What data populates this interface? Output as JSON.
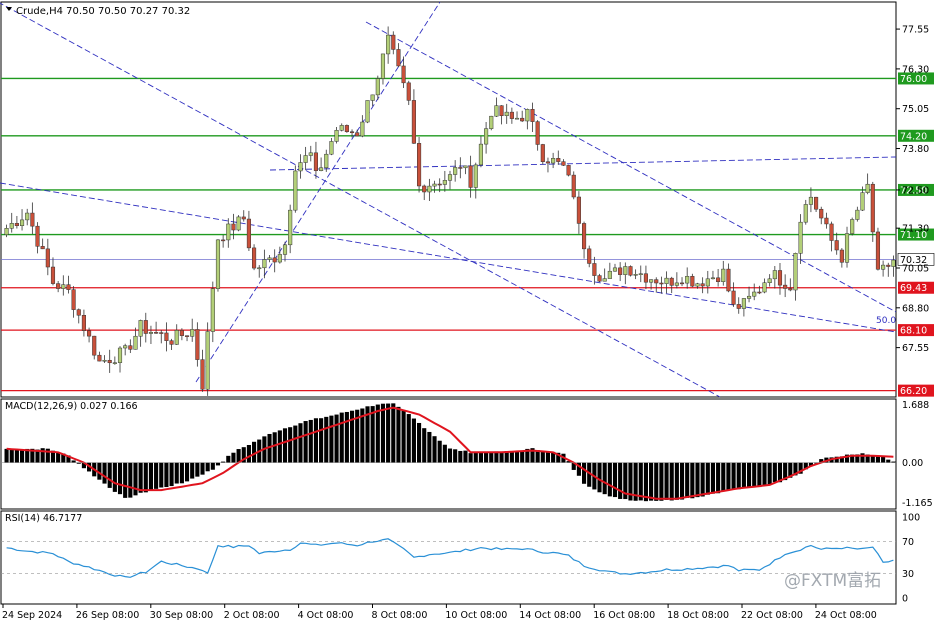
{
  "header": {
    "symbol_line": "Crude,H4  70.50 70.50 70.27 70.32",
    "symbol": "Crude",
    "timeframe": "H4",
    "open": 70.5,
    "high": 70.5,
    "low": 70.27,
    "close": 70.32
  },
  "colors": {
    "bull_candle": "#b3cf78",
    "bear_candle": "#c9503a",
    "wick": "#333333",
    "support_line": "#e0141e",
    "resistance_line": "#1f9a1f",
    "trend_line": "#3030c0",
    "macd_hist": "#000000",
    "macd_signal": "#e0141e",
    "rsi_line": "#2a90d6",
    "current_price_line": "#7070d0"
  },
  "chart_data": [
    {
      "type": "candlestick",
      "name": "price",
      "ylim": [
        66.0,
        78.4
      ],
      "yticks": [
        67.55,
        68.8,
        70.05,
        71.3,
        72.5,
        73.8,
        75.05,
        76.3,
        77.55
      ],
      "x": [
        "24 Sep 2024",
        "26 Sep 08:00",
        "30 Sep 08:00",
        "2 Oct 08:00",
        "4 Oct 08:00",
        "8 Oct 08:00",
        "10 Oct 08:00",
        "14 Oct 08:00",
        "16 Oct 08:00",
        "18 Oct 08:00",
        "22 Oct 08:00",
        "24 Oct 08:00"
      ],
      "horizontal_levels": [
        {
          "value": 76.0,
          "label": "76.00",
          "kind": "resistance"
        },
        {
          "value": 74.2,
          "label": "74.20",
          "kind": "resistance"
        },
        {
          "value": 72.5,
          "label": "72.50",
          "kind": "resistance"
        },
        {
          "value": 71.1,
          "label": "71.10",
          "kind": "resistance"
        },
        {
          "value": 69.43,
          "label": "69.43",
          "kind": "support"
        },
        {
          "value": 68.1,
          "label": "68.10",
          "kind": "support"
        },
        {
          "value": 66.2,
          "label": "66.20",
          "kind": "support"
        }
      ],
      "current_price": {
        "value": 70.32,
        "label": "70.32"
      },
      "annotation": "50.0",
      "anchors": [
        [
          71.3,
          0
        ],
        [
          71.8,
          4
        ],
        [
          69.6,
          9
        ],
        [
          69.3,
          12
        ],
        [
          67.1,
          18
        ],
        [
          67.4,
          23
        ],
        [
          68.2,
          26
        ],
        [
          67.8,
          32
        ],
        [
          68.1,
          36
        ],
        [
          66.4,
          38
        ],
        [
          71.0,
          41
        ],
        [
          71.6,
          46
        ],
        [
          70.0,
          48
        ],
        [
          70.4,
          52
        ],
        [
          70.8,
          54
        ],
        [
          73.3,
          56
        ],
        [
          73.6,
          59
        ],
        [
          72.9,
          60
        ],
        [
          74.4,
          64
        ],
        [
          74.3,
          68
        ],
        [
          76.1,
          72
        ],
        [
          77.2,
          74
        ],
        [
          75.2,
          78
        ],
        [
          72.6,
          80
        ],
        [
          72.9,
          86
        ],
        [
          73.3,
          88
        ],
        [
          72.8,
          90
        ],
        [
          75.0,
          94
        ],
        [
          74.7,
          98
        ],
        [
          74.9,
          101
        ],
        [
          73.6,
          104
        ],
        [
          73.2,
          108
        ],
        [
          72.4,
          110
        ],
        [
          71.3,
          111
        ],
        [
          70.8,
          112
        ],
        [
          70.0,
          114
        ],
        [
          69.7,
          116
        ],
        [
          70.1,
          120
        ],
        [
          69.8,
          124
        ],
        [
          69.6,
          128
        ],
        [
          69.8,
          131
        ],
        [
          69.6,
          134
        ],
        [
          69.9,
          139
        ],
        [
          68.8,
          141
        ],
        [
          68.9,
          143
        ],
        [
          69.4,
          146
        ],
        [
          69.9,
          148
        ],
        [
          69.5,
          152
        ],
        [
          71.7,
          154
        ],
        [
          72.3,
          156
        ],
        [
          70.9,
          160
        ],
        [
          70.4,
          162
        ],
        [
          71.5,
          164
        ],
        [
          72.6,
          167
        ],
        [
          69.8,
          169
        ],
        [
          70.3,
          172
        ]
      ]
    },
    {
      "type": "macd",
      "name": "MACD(12,26,9)",
      "label": "MACD(12,26,9) 0.027 0.166",
      "macd": 0.027,
      "signal": 0.166,
      "ylim": [
        -1.35,
        1.85
      ],
      "yticks": [
        1.688,
        0.0,
        -1.165
      ],
      "ytick_labels": [
        "1.688",
        "0.00",
        "-1.165"
      ],
      "hist_anchors": [
        [
          0.4,
          0
        ],
        [
          0.4,
          8
        ],
        [
          0.2,
          12
        ],
        [
          -0.5,
          18
        ],
        [
          -1.05,
          23
        ],
        [
          -0.8,
          28
        ],
        [
          -0.6,
          34
        ],
        [
          -0.2,
          40
        ],
        [
          0.3,
          44
        ],
        [
          0.6,
          48
        ],
        [
          0.9,
          52
        ],
        [
          1.2,
          58
        ],
        [
          1.4,
          64
        ],
        [
          1.55,
          68
        ],
        [
          1.7,
          72
        ],
        [
          1.7,
          75
        ],
        [
          1.4,
          78
        ],
        [
          0.9,
          82
        ],
        [
          0.4,
          86
        ],
        [
          0.3,
          90
        ],
        [
          0.3,
          96
        ],
        [
          0.4,
          102
        ],
        [
          0.25,
          108
        ],
        [
          -0.2,
          110
        ],
        [
          -0.6,
          112
        ],
        [
          -1.0,
          117
        ],
        [
          -1.1,
          122
        ],
        [
          -1.1,
          128
        ],
        [
          -1.0,
          134
        ],
        [
          -0.8,
          140
        ],
        [
          -0.7,
          146
        ],
        [
          -0.55,
          150
        ],
        [
          -0.3,
          154
        ],
        [
          -0.1,
          156
        ],
        [
          0.1,
          158
        ],
        [
          0.2,
          162
        ],
        [
          0.25,
          166
        ],
        [
          0.15,
          170
        ],
        [
          0.03,
          172
        ]
      ],
      "signal_anchors": [
        [
          0.4,
          0
        ],
        [
          0.3,
          10
        ],
        [
          0.0,
          15
        ],
        [
          -0.6,
          21
        ],
        [
          -0.8,
          26
        ],
        [
          -0.8,
          30
        ],
        [
          -0.6,
          38
        ],
        [
          -0.3,
          42
        ],
        [
          0.1,
          46
        ],
        [
          0.4,
          50
        ],
        [
          0.7,
          56
        ],
        [
          1.0,
          62
        ],
        [
          1.3,
          68
        ],
        [
          1.5,
          72
        ],
        [
          1.6,
          75
        ],
        [
          1.4,
          80
        ],
        [
          0.9,
          86
        ],
        [
          0.3,
          90
        ],
        [
          0.3,
          96
        ],
        [
          0.35,
          102
        ],
        [
          0.3,
          106
        ],
        [
          0.0,
          110
        ],
        [
          -0.5,
          115
        ],
        [
          -0.9,
          120
        ],
        [
          -1.05,
          126
        ],
        [
          -1.05,
          130
        ],
        [
          -0.9,
          136
        ],
        [
          -0.75,
          142
        ],
        [
          -0.65,
          148
        ],
        [
          -0.4,
          152
        ],
        [
          -0.1,
          156
        ],
        [
          0.1,
          160
        ],
        [
          0.2,
          164
        ],
        [
          0.2,
          168
        ],
        [
          0.17,
          172
        ]
      ]
    },
    {
      "type": "line",
      "name": "RSI(14)",
      "label": "RSI(14) 46.7177",
      "value": 46.7177,
      "ylim": [
        0,
        100
      ],
      "yticks": [
        100,
        70,
        30,
        0
      ],
      "levels": [
        70,
        30
      ],
      "anchors": [
        [
          62,
          0
        ],
        [
          58,
          4
        ],
        [
          55,
          9
        ],
        [
          45,
          12
        ],
        [
          38,
          16
        ],
        [
          30,
          20
        ],
        [
          25,
          23
        ],
        [
          32,
          27
        ],
        [
          45,
          30
        ],
        [
          40,
          34
        ],
        [
          35,
          38
        ],
        [
          30,
          39
        ],
        [
          65,
          41
        ],
        [
          63,
          44
        ],
        [
          65,
          47
        ],
        [
          55,
          49
        ],
        [
          58,
          52
        ],
        [
          60,
          55
        ],
        [
          68,
          57
        ],
        [
          65,
          60
        ],
        [
          68,
          64
        ],
        [
          65,
          68
        ],
        [
          70,
          71
        ],
        [
          72,
          74
        ],
        [
          60,
          77
        ],
        [
          50,
          79
        ],
        [
          54,
          82
        ],
        [
          56,
          86
        ],
        [
          58,
          88
        ],
        [
          62,
          92
        ],
        [
          60,
          96
        ],
        [
          61,
          100
        ],
        [
          57,
          104
        ],
        [
          55,
          107
        ],
        [
          52,
          109
        ],
        [
          48,
          110
        ],
        [
          40,
          112
        ],
        [
          35,
          115
        ],
        [
          32,
          117
        ],
        [
          30,
          120
        ],
        [
          32,
          124
        ],
        [
          35,
          128
        ],
        [
          36,
          132
        ],
        [
          38,
          136
        ],
        [
          40,
          140
        ],
        [
          34,
          142
        ],
        [
          35,
          146
        ],
        [
          46,
          149
        ],
        [
          55,
          151
        ],
        [
          58,
          153
        ],
        [
          65,
          156
        ],
        [
          60,
          158
        ],
        [
          62,
          162
        ],
        [
          60,
          166
        ],
        [
          63,
          168
        ],
        [
          43,
          170
        ],
        [
          46.7,
          172
        ]
      ]
    }
  ],
  "watermark": "@FXTM富拓"
}
